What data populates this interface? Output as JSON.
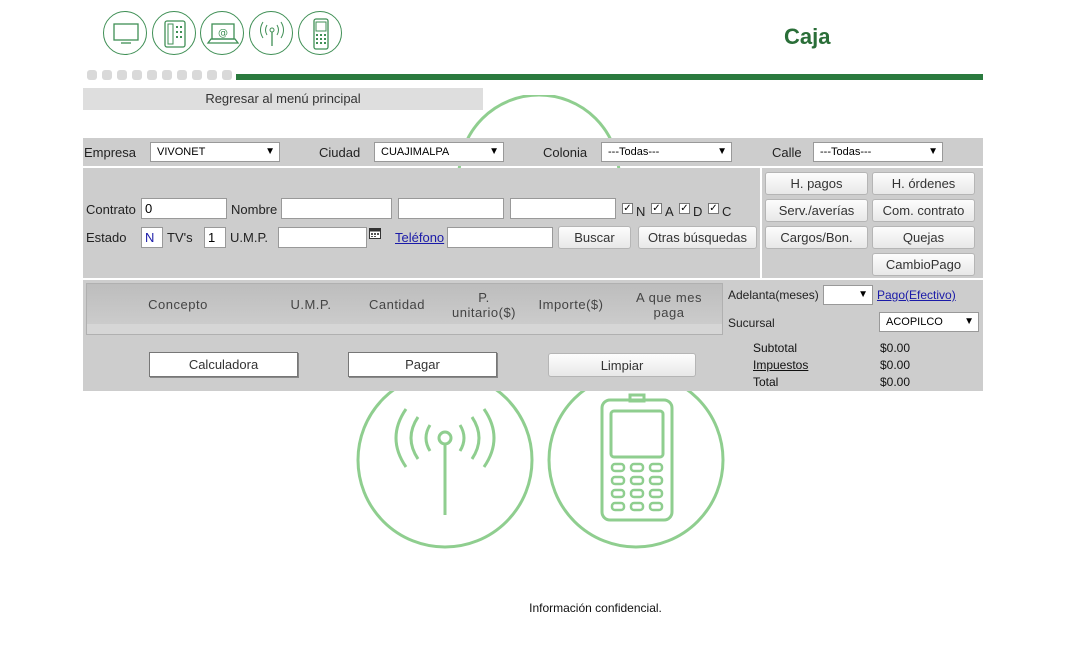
{
  "header": {
    "title": "Caja",
    "icons": [
      "tv-icon",
      "phone-icon",
      "laptop-email-icon",
      "antenna-icon",
      "mobile-icon"
    ]
  },
  "nav": {
    "back_label": "Regresar al menú principal"
  },
  "filters": {
    "empresa_label": "Empresa",
    "empresa_value": "VIVONET",
    "ciudad_label": "Ciudad",
    "ciudad_value": "CUAJIMALPA",
    "colonia_label": "Colonia",
    "colonia_value": "---Todas---",
    "calle_label": "Calle",
    "calle_value": "---Todas---"
  },
  "search": {
    "contrato_label": "Contrato",
    "contrato_value": "0",
    "nombre_label": "Nombre",
    "checks": [
      {
        "label": "N",
        "checked": true
      },
      {
        "label": "A",
        "checked": true
      },
      {
        "label": "D",
        "checked": true
      },
      {
        "label": "C",
        "checked": true
      }
    ],
    "estado_label": "Estado",
    "estado_value": "N",
    "tvs_label": "TV's",
    "tvs_value": "1",
    "ump_label": "U.M.P.",
    "telefono_label": "Teléfono",
    "buscar_label": "Buscar",
    "otras_label": "Otras búsquedas"
  },
  "actions": {
    "h_pagos": "H. pagos",
    "h_ordenes": "H. órdenes",
    "serv_averias": "Serv./averías",
    "com_contrato": "Com. contrato",
    "cargos_bon": "Cargos/Bon.",
    "quejas": "Quejas",
    "cambio_pago": "CambioPago"
  },
  "table": {
    "headers": [
      "Concepto",
      "U.M.P.",
      "Cantidad",
      "P. unitario($)",
      "Importe($)",
      "A que mes paga"
    ]
  },
  "payment": {
    "adelanta_label": "Adelanta(meses)",
    "pago_link": "Pago(Efectivo)",
    "sucursal_label": "Sucursal",
    "sucursal_value": "ACOPILCO",
    "subtotal_label": "Subtotal",
    "subtotal_value": "$0.00",
    "impuestos_label": "Impuestos",
    "impuestos_value": "$0.00",
    "total_label": "Total",
    "total_value": "$0.00"
  },
  "bottom_buttons": {
    "calculadora": "Calculadora",
    "pagar": "Pagar",
    "limpiar": "Limpiar"
  },
  "footer": {
    "text": "Información confidencial."
  },
  "colors": {
    "brand_green": "#2a7a3e",
    "panel_gray": "#cdcdcd",
    "link_blue": "#1a1aa8"
  }
}
